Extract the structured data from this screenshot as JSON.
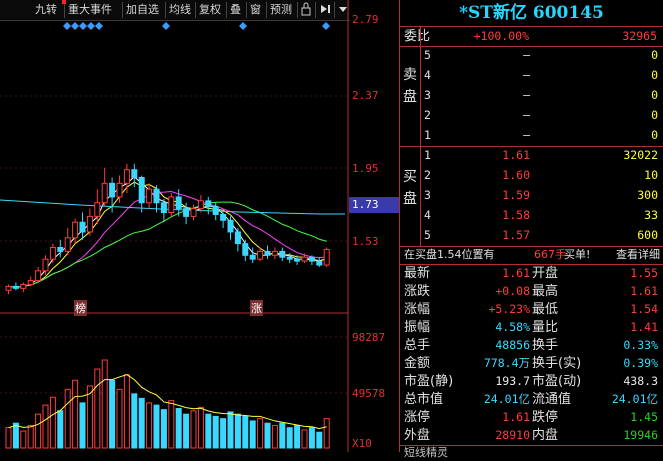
{
  "toolbar": {
    "items": [
      "九转",
      "重大事件",
      "加自选",
      "均线",
      "复权",
      "叠",
      "窗",
      "预测"
    ],
    "lock_icon": "lock-icon",
    "arrow_icon": "arrow-end-icon",
    "menu_icon": "dropdown-icon"
  },
  "price_axis": [
    "2.79",
    "2.37",
    "1.95",
    "1.73",
    "1.53"
  ],
  "vol_axis": [
    "98287",
    "49578",
    "X10"
  ],
  "kline_markers": [
    "榜",
    "涨"
  ],
  "header": {
    "title": "*ST新亿 600145"
  },
  "weibi": {
    "label": "委比",
    "pct": "+100.00%",
    "diff": "32965"
  },
  "sell_label": "卖盘",
  "buy_label": "买盘",
  "sell": [
    {
      "lvl": "5",
      "price": "–",
      "vol": "0"
    },
    {
      "lvl": "4",
      "price": "–",
      "vol": "0"
    },
    {
      "lvl": "3",
      "price": "–",
      "vol": "0"
    },
    {
      "lvl": "2",
      "price": "–",
      "vol": "0"
    },
    {
      "lvl": "1",
      "price": "–",
      "vol": "0"
    }
  ],
  "buy": [
    {
      "lvl": "1",
      "price": "1.61",
      "vol": "32022"
    },
    {
      "lvl": "2",
      "price": "1.60",
      "vol": "10"
    },
    {
      "lvl": "3",
      "price": "1.59",
      "vol": "300"
    },
    {
      "lvl": "4",
      "price": "1.58",
      "vol": "33"
    },
    {
      "lvl": "5",
      "price": "1.57",
      "vol": "600"
    }
  ],
  "notice": {
    "text": "在买盘1.54位置有",
    "vol": "667手",
    "action": "买单!",
    "link": "查看详细"
  },
  "stats": [
    {
      "l1": "最新",
      "v1": "1.61",
      "c1": "red",
      "l2": "开盘",
      "v2": "1.55",
      "c2": "red"
    },
    {
      "l1": "涨跌",
      "v1": "+0.08",
      "c1": "red",
      "l2": "最高",
      "v2": "1.61",
      "c2": "red"
    },
    {
      "l1": "涨幅",
      "v1": "+5.23%",
      "c1": "red",
      "l2": "最低",
      "v2": "1.54",
      "c2": "red"
    },
    {
      "l1": "振幅",
      "v1": "4.58%",
      "c1": "cy",
      "l2": "量比",
      "v2": "1.41",
      "c2": "red"
    },
    {
      "l1": "总手",
      "v1": "48856",
      "c1": "cy",
      "l2": "换手",
      "v2": "0.33%",
      "c2": "cy"
    },
    {
      "l1": "金额",
      "v1": "778.4万",
      "c1": "cy",
      "l2": "换手(实)",
      "v2": "0.39%",
      "c2": "cy"
    },
    {
      "l1": "市盈(静)",
      "v1": "193.7",
      "c1": "wh",
      "l2": "市盈(动)",
      "v2": "438.3",
      "c2": "wh"
    },
    {
      "l1": "总市值",
      "v1": "24.01亿",
      "c1": "cy",
      "l2": "流通值",
      "v2": "24.01亿",
      "c2": "cy"
    },
    {
      "l1": "涨停",
      "v1": "1.61",
      "c1": "red",
      "l2": "跌停",
      "v2": "1.45",
      "c2": "grn"
    },
    {
      "l1": "外盘",
      "v1": "28910",
      "c1": "red",
      "l2": "内盘",
      "v2": "19946",
      "c2": "grn"
    }
  ],
  "bottom_cut": "短线精灵",
  "chart_data": {
    "type": "candlestick",
    "ylim": [
      1.35,
      2.79
    ],
    "highlight_price": "1.73",
    "candles": [
      [
        1.4,
        1.42,
        1.38,
        1.43
      ],
      [
        1.42,
        1.41,
        1.4,
        1.44
      ],
      [
        1.41,
        1.43,
        1.39,
        1.44
      ],
      [
        1.43,
        1.45,
        1.42,
        1.47
      ],
      [
        1.45,
        1.5,
        1.44,
        1.52
      ],
      [
        1.5,
        1.56,
        1.48,
        1.58
      ],
      [
        1.56,
        1.62,
        1.54,
        1.64
      ],
      [
        1.62,
        1.6,
        1.57,
        1.66
      ],
      [
        1.6,
        1.67,
        1.58,
        1.72
      ],
      [
        1.67,
        1.75,
        1.64,
        1.77
      ],
      [
        1.75,
        1.7,
        1.66,
        1.8
      ],
      [
        1.7,
        1.78,
        1.68,
        1.82
      ],
      [
        1.78,
        1.85,
        1.74,
        1.92
      ],
      [
        1.85,
        1.95,
        1.83,
        2.03
      ],
      [
        1.95,
        1.88,
        1.8,
        1.98
      ],
      [
        1.88,
        1.95,
        1.85,
        1.99
      ],
      [
        1.95,
        2.02,
        1.9,
        2.05
      ],
      [
        2.02,
        1.98,
        1.93,
        2.05
      ],
      [
        1.98,
        1.85,
        1.8,
        1.99
      ],
      [
        1.85,
        1.92,
        1.82,
        1.95
      ],
      [
        1.92,
        1.85,
        1.8,
        1.94
      ],
      [
        1.85,
        1.8,
        1.75,
        1.87
      ],
      [
        1.8,
        1.88,
        1.78,
        1.9
      ],
      [
        1.88,
        1.82,
        1.78,
        1.92
      ],
      [
        1.82,
        1.78,
        1.74,
        1.85
      ],
      [
        1.78,
        1.82,
        1.76,
        1.84
      ],
      [
        1.82,
        1.86,
        1.8,
        1.89
      ],
      [
        1.86,
        1.83,
        1.79,
        1.88
      ],
      [
        1.83,
        1.79,
        1.76,
        1.85
      ],
      [
        1.79,
        1.76,
        1.72,
        1.8
      ],
      [
        1.76,
        1.7,
        1.66,
        1.78
      ],
      [
        1.7,
        1.64,
        1.6,
        1.72
      ],
      [
        1.64,
        1.58,
        1.55,
        1.66
      ],
      [
        1.58,
        1.56,
        1.54,
        1.62
      ],
      [
        1.56,
        1.6,
        1.55,
        1.62
      ],
      [
        1.6,
        1.58,
        1.56,
        1.63
      ],
      [
        1.58,
        1.6,
        1.56,
        1.62
      ],
      [
        1.6,
        1.57,
        1.55,
        1.62
      ],
      [
        1.57,
        1.56,
        1.54,
        1.59
      ],
      [
        1.56,
        1.55,
        1.53,
        1.58
      ],
      [
        1.55,
        1.57,
        1.54,
        1.59
      ],
      [
        1.57,
        1.55,
        1.53,
        1.58
      ],
      [
        1.55,
        1.53,
        1.52,
        1.57
      ],
      [
        1.53,
        1.61,
        1.52,
        1.62
      ]
    ],
    "volumes": [
      18,
      22,
      15,
      20,
      30,
      38,
      45,
      33,
      52,
      60,
      40,
      55,
      70,
      78,
      60,
      52,
      65,
      48,
      44,
      40,
      38,
      34,
      42,
      35,
      30,
      33,
      36,
      30,
      28,
      26,
      32,
      30,
      28,
      24,
      26,
      22,
      20,
      22,
      18,
      20,
      16,
      18,
      14,
      26
    ],
    "vol_ylim": [
      0,
      98287
    ]
  }
}
